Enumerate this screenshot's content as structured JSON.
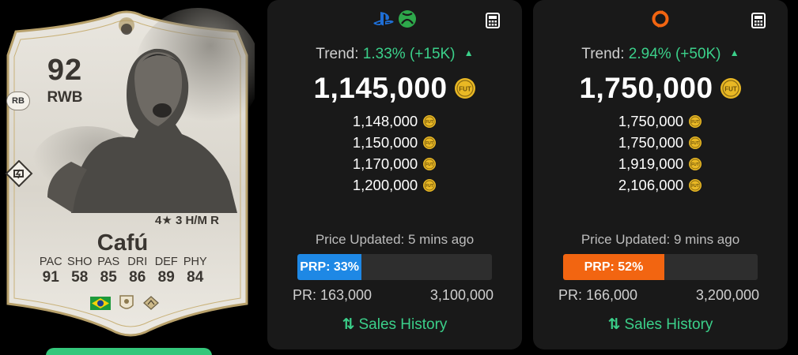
{
  "card": {
    "rating": "92",
    "position": "RWB",
    "alt_position": "RB",
    "skills_line": "4★ 3 H/M R",
    "name": "Cafú",
    "stats": [
      {
        "label": "PAC",
        "value": "91"
      },
      {
        "label": "SHO",
        "value": "58"
      },
      {
        "label": "PAS",
        "value": "85"
      },
      {
        "label": "DRI",
        "value": "86"
      },
      {
        "label": "DEF",
        "value": "89"
      },
      {
        "label": "PHY",
        "value": "84"
      }
    ],
    "flags": [
      "brazil-flag-icon",
      "icon-club-badge",
      "league-badge-icon"
    ]
  },
  "panels": [
    {
      "platform_icons": [
        "playstation-icon",
        "xbox-icon"
      ],
      "trend_label": "Trend:",
      "trend_value": "1.33% (+15K)",
      "trend_direction": "up",
      "main_price": "1,145,000",
      "prices": [
        "1,148,000",
        "1,150,000",
        "1,170,000",
        "1,200,000"
      ],
      "updated": "Price Updated: 5 mins ago",
      "prp_label": "PRP: 33%",
      "prp_percent": 33,
      "prp_color": "#1e88e5",
      "pr_min": "PR: 163,000",
      "pr_max": "3,100,000",
      "sales_label": "Sales History"
    },
    {
      "platform_icons": [
        "origin-pc-icon"
      ],
      "trend_label": "Trend:",
      "trend_value": "2.94% (+50K)",
      "trend_direction": "up",
      "main_price": "1,750,000",
      "prices": [
        "1,750,000",
        "1,750,000",
        "1,919,000",
        "2,106,000"
      ],
      "updated": "Price Updated: 9 mins ago",
      "prp_label": "PRP: 52%",
      "prp_percent": 52,
      "prp_color": "#f26511",
      "pr_min": "PR: 166,000",
      "pr_max": "3,200,000",
      "sales_label": "Sales History"
    }
  ],
  "colors": {
    "trend_green": "#3bd08a",
    "coin_gold": "#e9b824",
    "panel_bg": "#191919"
  }
}
